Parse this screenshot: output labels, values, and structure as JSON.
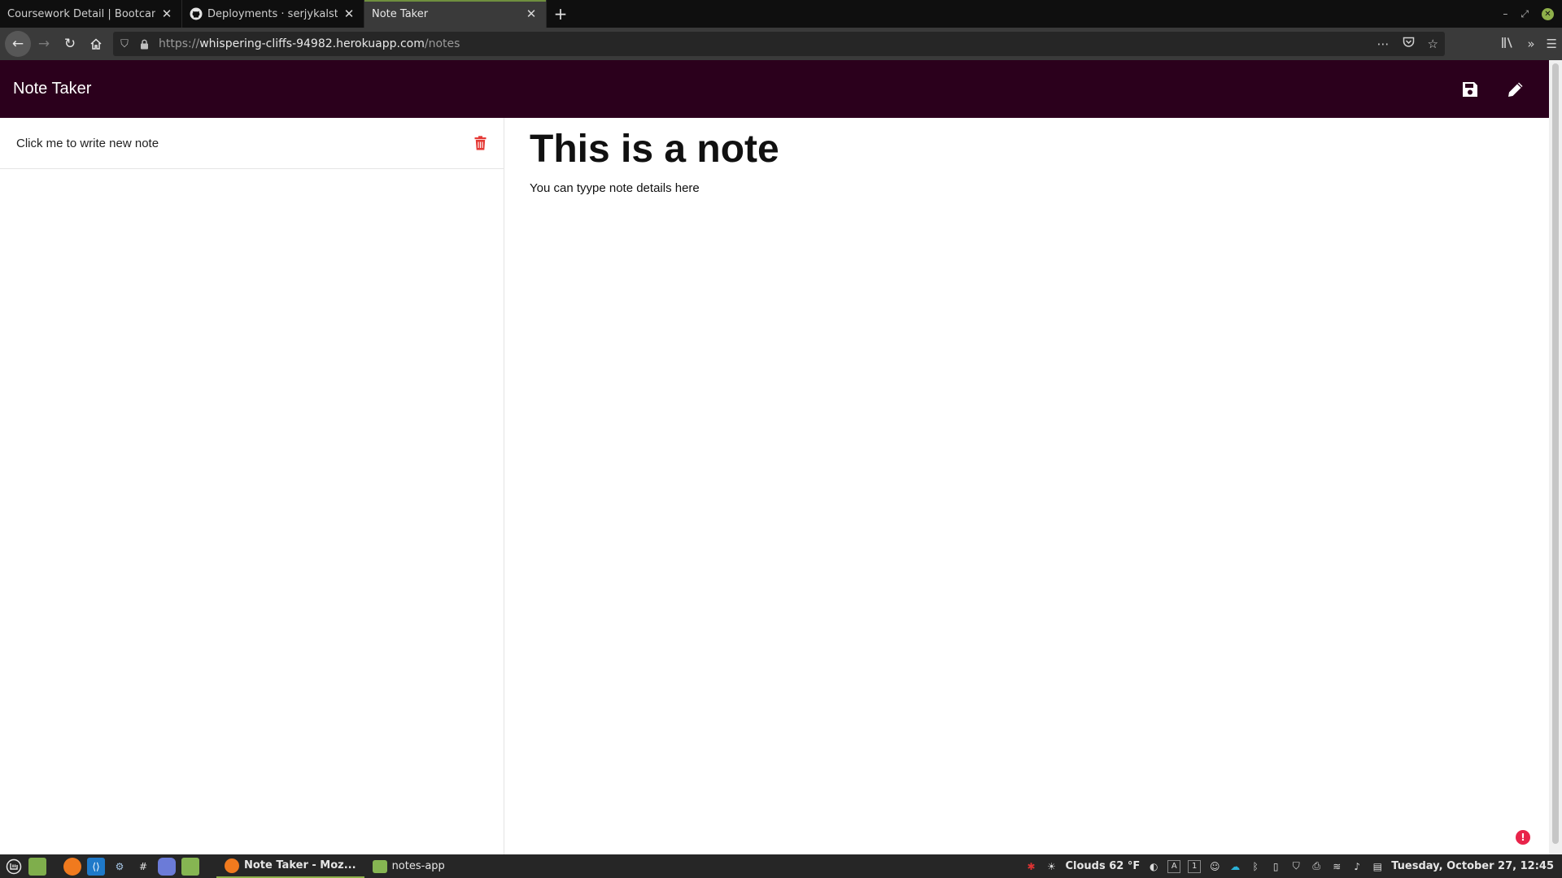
{
  "browser": {
    "tabs": [
      {
        "title": "Coursework Detail | Bootcamp",
        "active": false
      },
      {
        "title": "Deployments · serjykalstry",
        "active": false
      },
      {
        "title": "Note Taker",
        "active": true
      }
    ],
    "url": {
      "scheme": "https://",
      "host": "whispering-cliffs-94982.herokuapp.com",
      "path": "/notes"
    }
  },
  "app": {
    "title": "Note Taker",
    "sidebar": {
      "items": [
        {
          "label": "Click me to write new note"
        }
      ]
    },
    "editor": {
      "title": "This is a note",
      "text": "You can tyype note details here"
    },
    "colors": {
      "header_bg": "#2b001c",
      "trash": "#e53935"
    }
  },
  "taskbar": {
    "windows": [
      {
        "label": "Note Taker - Moz...",
        "active": true
      },
      {
        "label": "notes-app",
        "active": false
      }
    ],
    "weather": "Clouds 62 °F",
    "keyboard_indicators": [
      "A",
      "1"
    ],
    "clock": "Tuesday, October 27, 12:45"
  }
}
